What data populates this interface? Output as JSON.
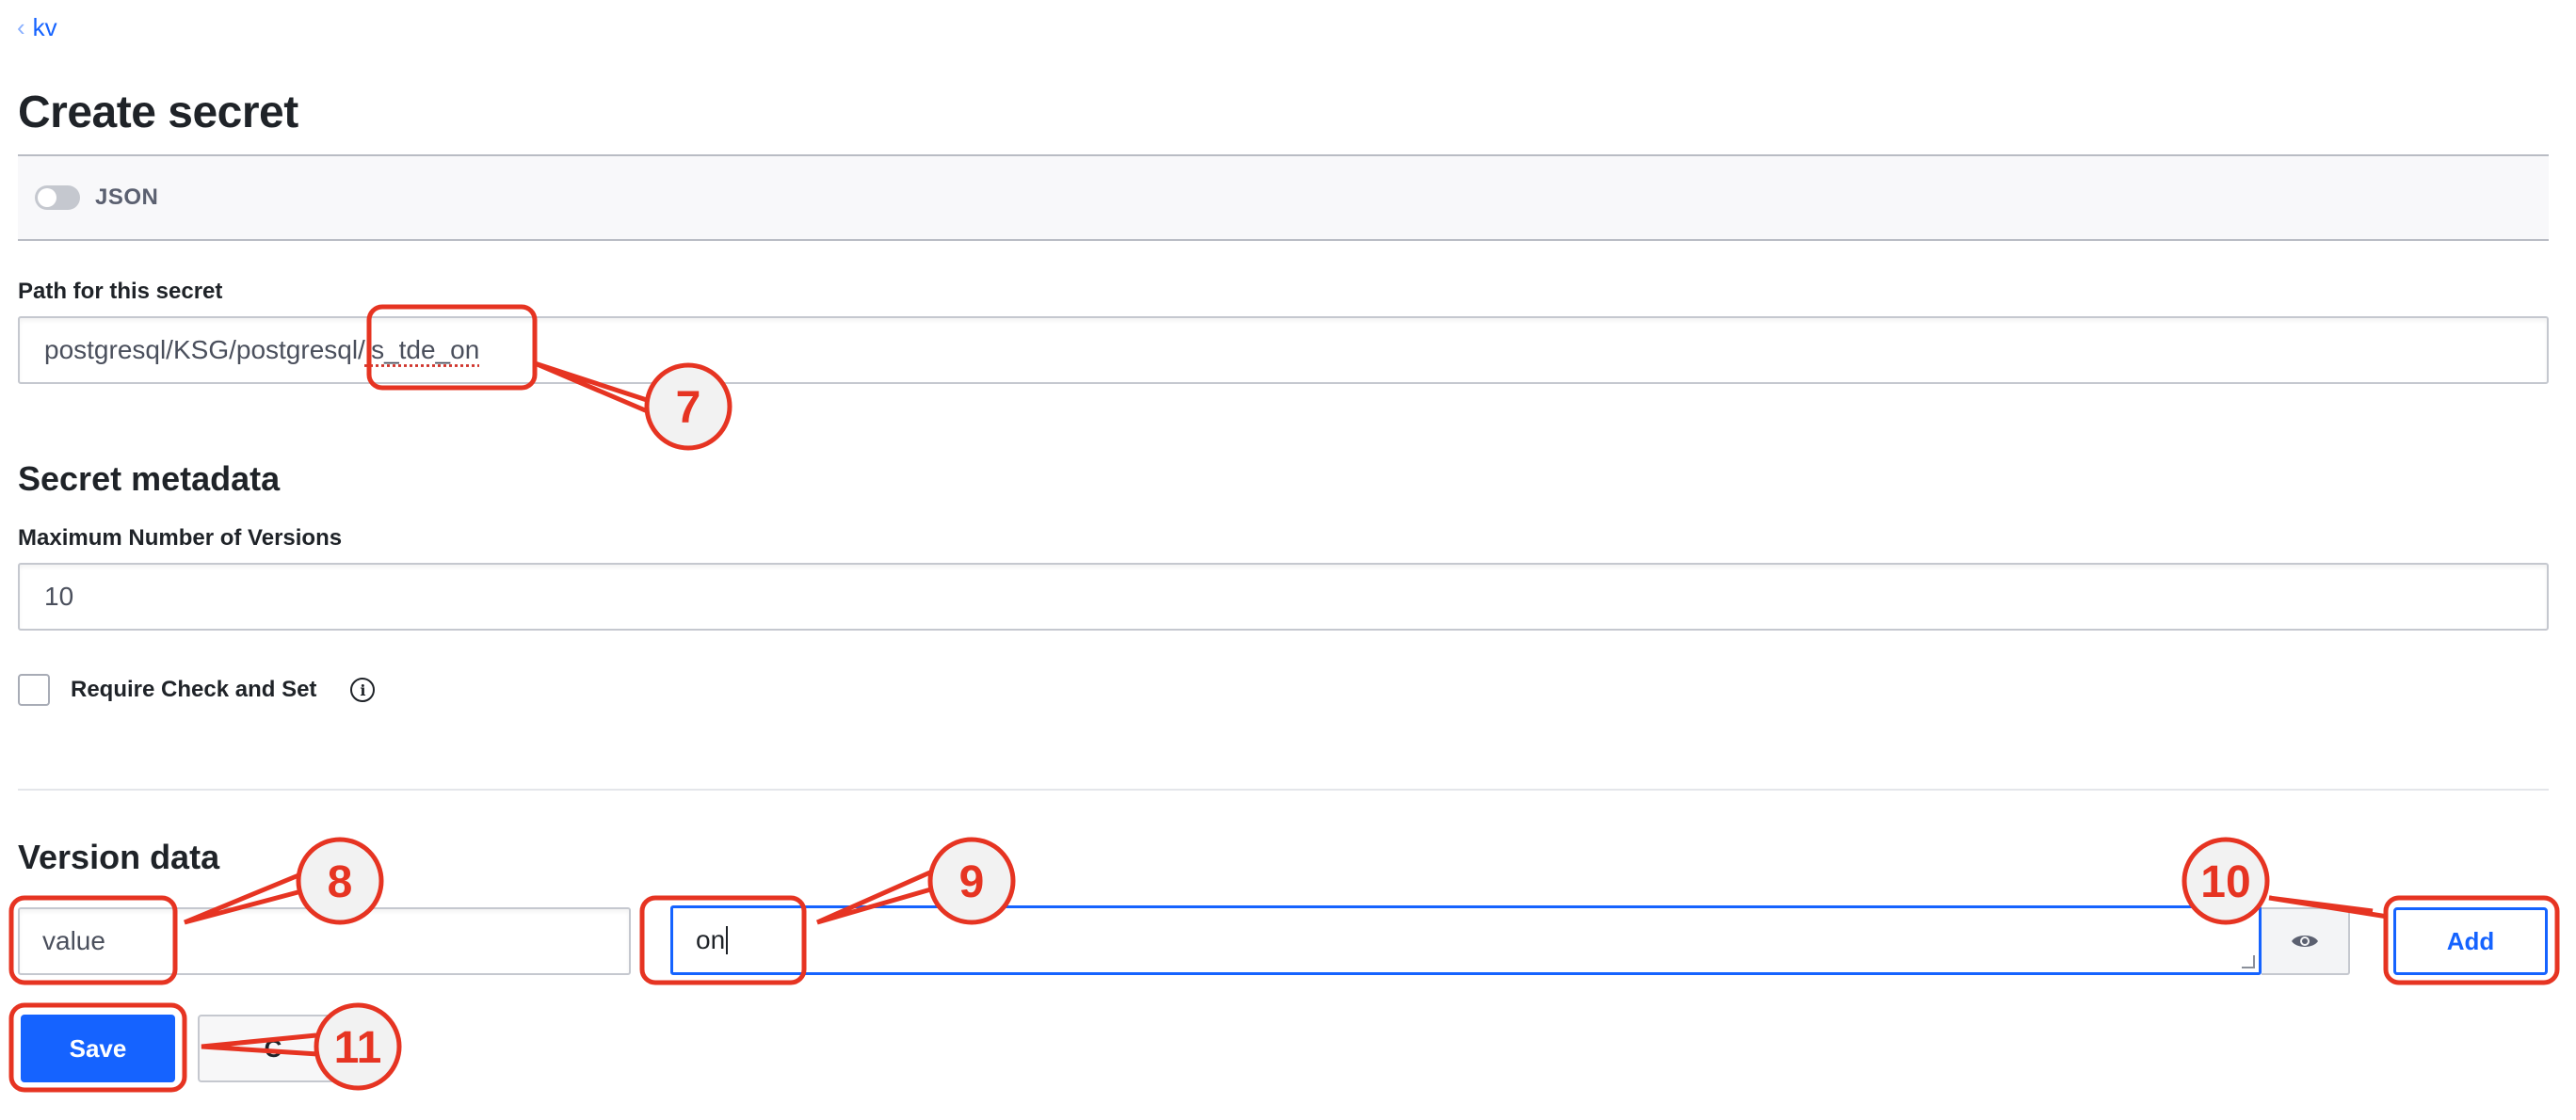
{
  "breadcrumb": {
    "label": "kv"
  },
  "page": {
    "title": "Create secret"
  },
  "json_toggle": {
    "label": "JSON",
    "enabled": false
  },
  "path": {
    "label": "Path for this secret",
    "value_prefix": "postgresql/KSG/postgresql/",
    "value_suffix": "is_tde_on"
  },
  "metadata": {
    "heading": "Secret metadata",
    "max_versions_label": "Maximum Number of Versions",
    "max_versions_value": "10",
    "cas_label": "Require Check and Set",
    "cas_checked": false
  },
  "version_data": {
    "heading": "Version data",
    "key": "value",
    "value": "on",
    "add_label": "Add"
  },
  "actions": {
    "save_label": "Save",
    "cancel_label": "C"
  },
  "annotations": {
    "n7": "7",
    "n8": "8",
    "n9": "9",
    "n10": "10",
    "n11": "11"
  },
  "colors": {
    "accent": "#1563ff",
    "annotation": "#e63422"
  }
}
